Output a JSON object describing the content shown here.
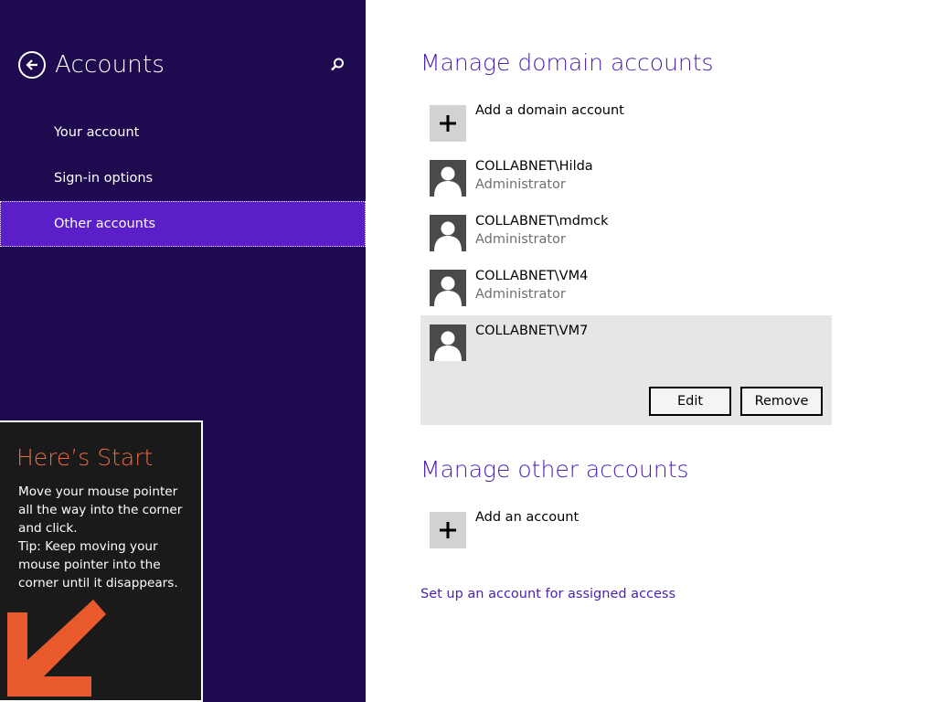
{
  "nav": {
    "title": "Accounts",
    "items": [
      {
        "label": "Your account"
      },
      {
        "label": "Sign-in options"
      },
      {
        "label": "Other accounts",
        "selected": true
      }
    ]
  },
  "tip": {
    "title": "Here’s Start",
    "lines": [
      "Move your mouse pointer",
      "all the way into the corner",
      "and click.",
      "Tip: Keep moving your",
      "mouse pointer into the",
      "corner until it disappears."
    ]
  },
  "domain": {
    "title": "Manage domain accounts",
    "add_label": "Add a domain account",
    "accounts": [
      {
        "name": "COLLABNET\\Hilda",
        "role": "Administrator"
      },
      {
        "name": "COLLABNET\\mdmck",
        "role": "Administrator"
      },
      {
        "name": "COLLABNET\\VM4",
        "role": "Administrator"
      },
      {
        "name": "COLLABNET\\VM7",
        "role": ""
      }
    ],
    "edit_label": "Edit",
    "remove_label": "Remove"
  },
  "other": {
    "title": "Manage other accounts",
    "add_label": "Add an account"
  },
  "assigned_access_link": "Set up an account for assigned access",
  "colors": {
    "nav_bg": "#1e0a4e",
    "nav_selected": "#5a1fc8",
    "accent": "#4b1fb0",
    "tip_title": "#ec6a3d"
  },
  "icons": [
    "back-arrow-icon",
    "search-icon",
    "plus-icon",
    "user-avatar-icon",
    "arrow-down-left-icon"
  ]
}
